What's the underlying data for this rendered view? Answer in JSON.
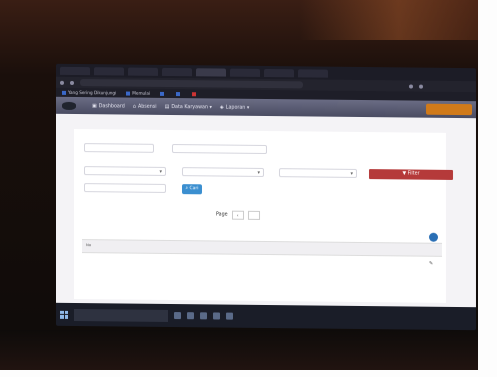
{
  "browser": {
    "tabs": [
      "",
      "",
      "",
      "",
      "",
      "",
      "",
      ""
    ],
    "url": "",
    "bookmarks": [
      {
        "label": "Yang Sering Dikunjungi",
        "color": "#3a68c8"
      },
      {
        "label": "Memulai",
        "color": "#3a68c8"
      },
      {
        "label": "",
        "color": "#3a68c8"
      },
      {
        "label": "",
        "color": "#3a68c8"
      },
      {
        "label": "",
        "color": "#c33333"
      }
    ]
  },
  "navbar": {
    "brand": "",
    "items": [
      "Dashboard",
      "Absensi",
      "Data Karyawan ▾",
      "Laporan ▾"
    ],
    "user": ""
  },
  "panel": {
    "title": "",
    "fields": {
      "date_from": "",
      "date_to": "",
      "select1": "",
      "select2": "",
      "select3": "",
      "keyword": ""
    },
    "filter_label": "Filter",
    "search_label": "Cari",
    "pager": {
      "label": "Page",
      "current": "",
      "of": ""
    },
    "count_text": "",
    "table": {
      "headers": [
        "No",
        "",
        "",
        "",
        "",
        ""
      ],
      "empty_message": "",
      "row_text": ""
    }
  },
  "taskbar": {
    "search_placeholder": "",
    "tray_time": ""
  },
  "colors": {
    "navbar": "#5a5c74",
    "filter_button": "#b53a3a",
    "search_button": "#3b8fd0",
    "user_button": "#d07a1a"
  }
}
